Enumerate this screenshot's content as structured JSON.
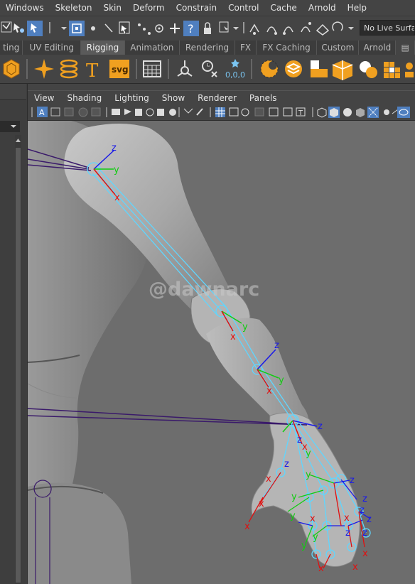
{
  "menu": [
    "Windows",
    "Skeleton",
    "Skin",
    "Deform",
    "Constrain",
    "Control",
    "Cache",
    "Arnold",
    "Help"
  ],
  "status_line": {
    "live_surface": "No Live Surface"
  },
  "shelf_tabs": [
    "ting",
    "UV Editing",
    "Rigging",
    "Animation",
    "Rendering",
    "FX",
    "FX Caching",
    "Custom",
    "Arnold"
  ],
  "shelf_active": "Rigging",
  "shelf_icons": [
    "polyhedron-icon",
    "star-burst-icon",
    "helix-icon",
    "text-T-icon",
    "svg-icon",
    "grid-icon",
    "locator-icon",
    "clock-delete-icon",
    "reset-000-icon",
    "sphere-cut-icon",
    "layers-icon",
    "blocks-icon",
    "cube-split-icon",
    "combine-icon",
    "grid-mesh-icon"
  ],
  "shelf_labels": {
    "text": "T",
    "svg": "svg",
    "reset": "0,0,0"
  },
  "viewport_menu": [
    "View",
    "Shading",
    "Lighting",
    "Show",
    "Renderer",
    "Panels"
  ],
  "watermark": "@dawnarc",
  "joint_labels": {
    "shoulder": [
      "z",
      "y",
      "x"
    ],
    "elbow": [
      "y",
      "x"
    ],
    "forearm": [
      "z",
      "y",
      "x"
    ],
    "wrist": [
      "z",
      "z",
      "y",
      "x"
    ],
    "fingers": [
      "z",
      "z",
      "z",
      "z",
      "z",
      "z",
      "z",
      "y",
      "y",
      "y",
      "y",
      "y",
      "x",
      "x",
      "x",
      "x",
      "x",
      "x",
      "x",
      "x"
    ]
  },
  "colors": {
    "x_axis": "#e01010",
    "y_axis": "#11cc11",
    "z_axis": "#1a1ae8",
    "bone": "#5fd6ff",
    "menubar_bg": "#444444",
    "viewport_bg": "#6d6d6d",
    "active_blue": "#4f7fbf"
  }
}
